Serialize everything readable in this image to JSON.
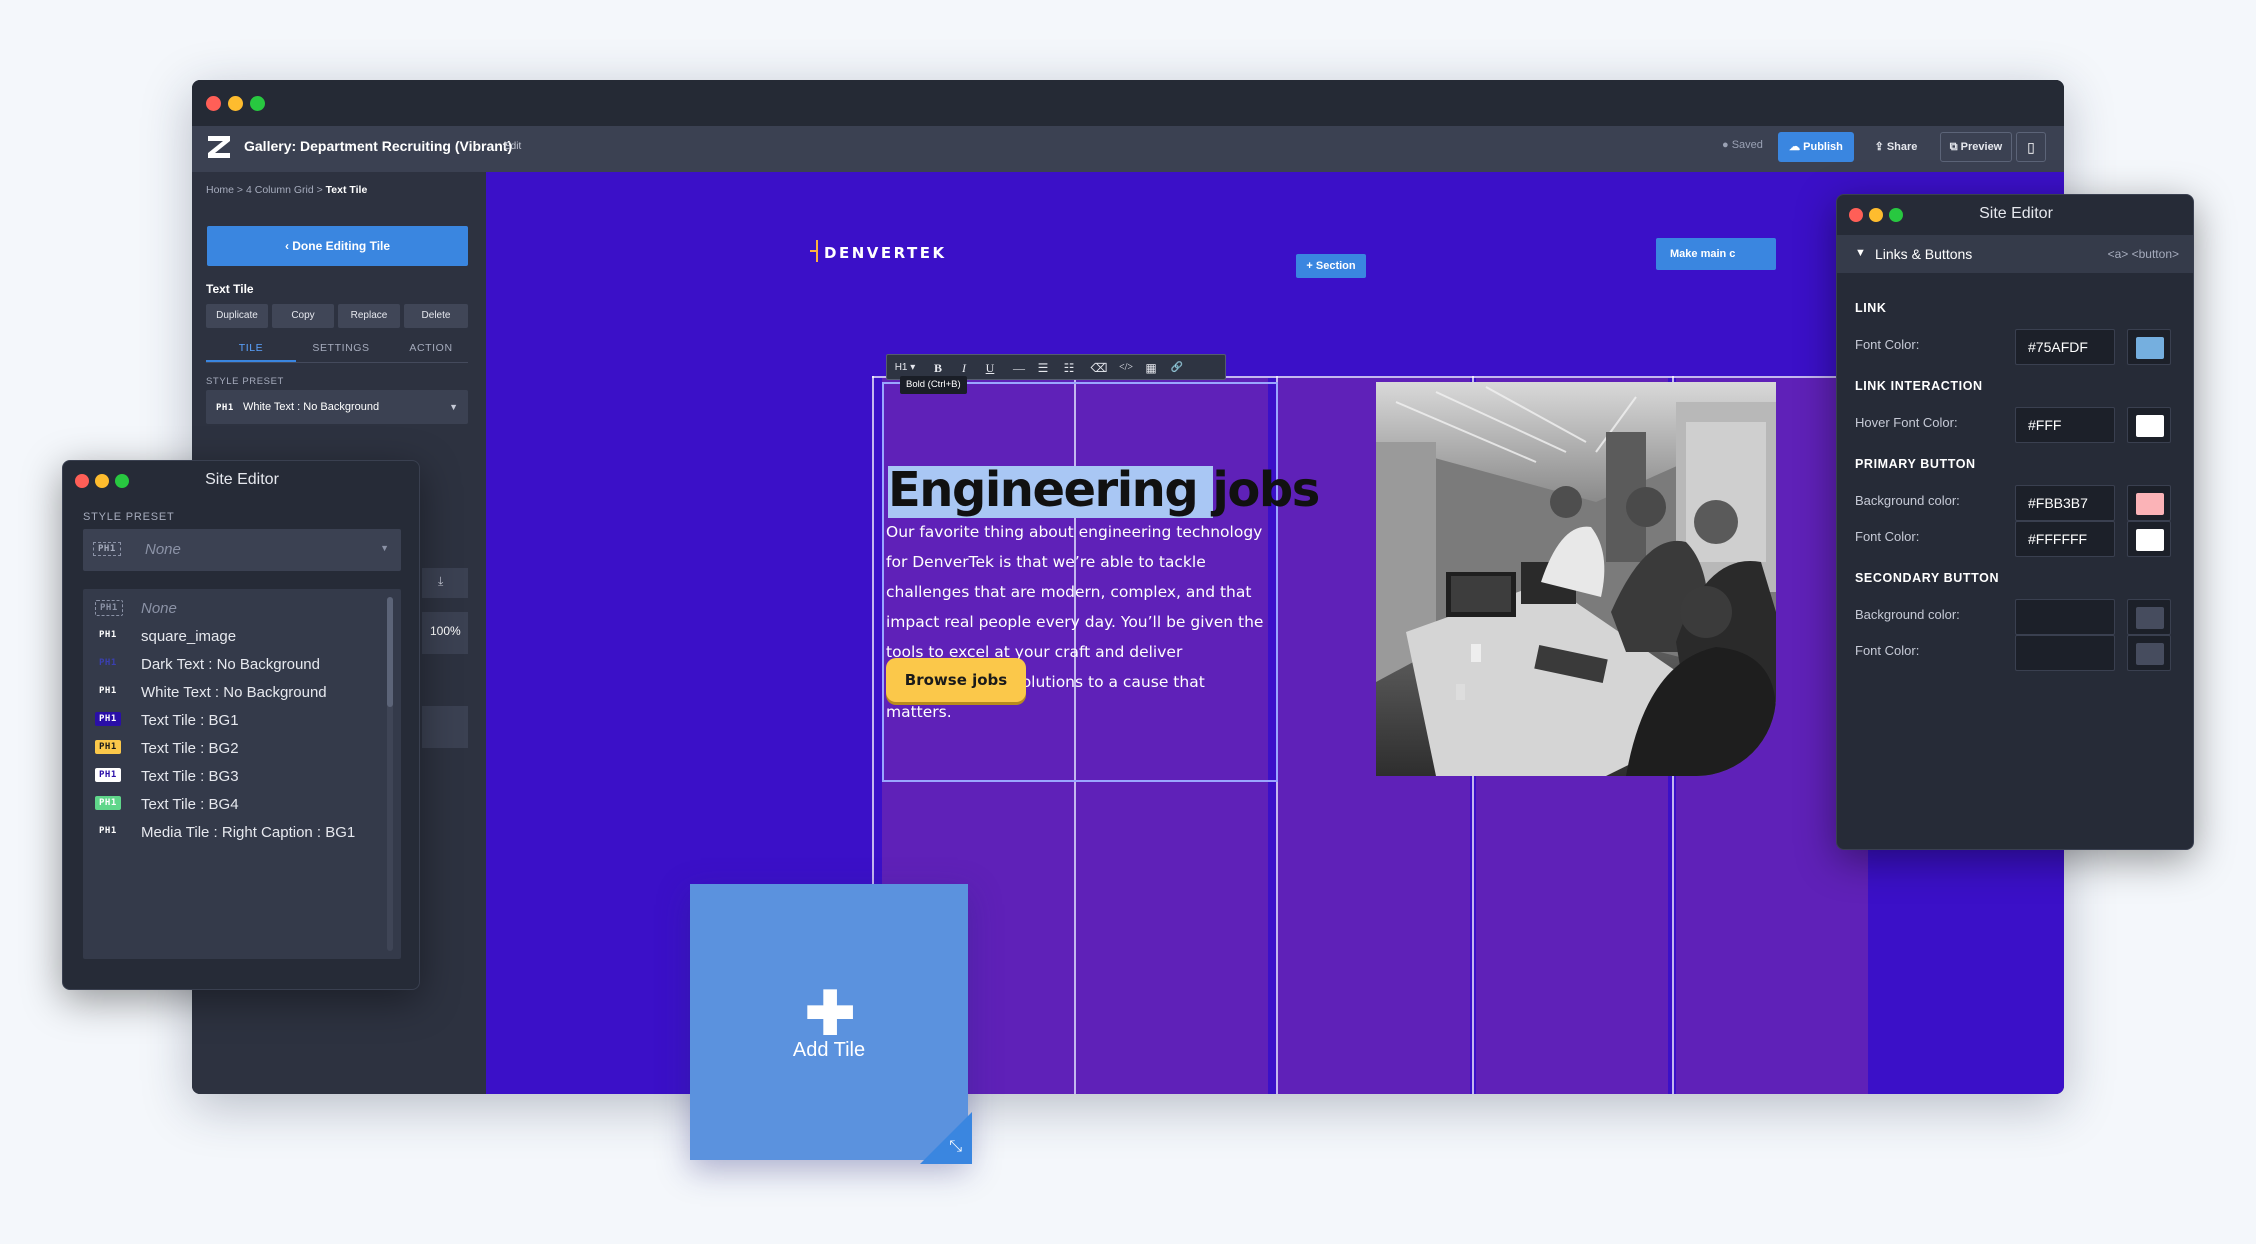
{
  "window": {
    "app_title": "Gallery: Department Recruiting (Vibrant)",
    "edit_link": "Edit",
    "saved_label": "Saved",
    "publish_label": "Publish",
    "share_label": "Share",
    "preview_label": "Preview"
  },
  "sidebar": {
    "breadcrumb": [
      "Home",
      "4 Column Grid",
      "Text Tile"
    ],
    "done_label": "‹ Done Editing Tile",
    "tile_heading": "Text Tile",
    "actions": [
      "Duplicate",
      "Copy",
      "Replace",
      "Delete"
    ],
    "tabs": [
      "TILE",
      "SETTINGS",
      "ACTION"
    ],
    "style_preset_label": "STYLE PRESET",
    "style_preset_value": "White Text : No Background",
    "ph1_badge": "PH1",
    "percent": "100%"
  },
  "canvas": {
    "logo_text": "DENVERTEK",
    "section_button": "+ Section",
    "make_main_button": "Make main c",
    "headline": "Engineering jobs",
    "body": "Our favorite thing about engineering technology for DenverTek is that we’re able to tackle challenges that are modern, complex, and that impact real people every day. You’ll be given the tools to excel at your craft and deliver groundbreaking solutions to a cause that matters.",
    "cta": "Browse jobs",
    "rte_buttons": [
      "H1 ▾",
      "B",
      "I",
      "U",
      "—",
      "☰",
      "☷",
      "⌫",
      "</>",
      "▦",
      "🔗"
    ],
    "tooltip": "Bold (Ctrl+B)",
    "add_tile_label": "Add Tile"
  },
  "site_editor_left": {
    "title": "Site Editor",
    "label": "STYLE PRESET",
    "selected": "None",
    "options": [
      {
        "label": "None",
        "badge": "PH1",
        "badge_color": "#343a4a",
        "text_color": "#8b92a6"
      },
      {
        "label": "square_image",
        "badge": "PH1",
        "badge_color": "transparent",
        "text_color": "#ffffff"
      },
      {
        "label": "Dark Text : No Background",
        "badge": "PH1",
        "badge_color": "transparent",
        "text_color": "#3a3fb0"
      },
      {
        "label": "White Text : No Background",
        "badge": "PH1",
        "badge_color": "transparent",
        "text_color": "#ffffff"
      },
      {
        "label": "Text Tile : BG1",
        "badge": "PH1",
        "badge_color": "#2a0fa8",
        "text_color": "#ffffff"
      },
      {
        "label": "Text Tile : BG2",
        "badge": "PH1",
        "badge_color": "#fbc84a",
        "text_color": "#1a1a1a"
      },
      {
        "label": "Text Tile : BG3",
        "badge": "PH1",
        "badge_color": "#ffffff",
        "text_color": "#2a0fa8"
      },
      {
        "label": "Text Tile : BG4",
        "badge": "PH1",
        "badge_color": "#5fd68a",
        "text_color": "#ffffff"
      },
      {
        "label": "Media Tile : Right Caption : BG1",
        "badge": "PH1",
        "badge_color": "transparent",
        "text_color": "#ffffff"
      }
    ]
  },
  "site_editor_right": {
    "title": "Site Editor",
    "section": "Links & Buttons",
    "tags": "<a> <button>",
    "link_group": "LINK",
    "link_font_label": "Font Color:",
    "link_font_value": "#75AFDF",
    "interaction_group": "LINK INTERACTION",
    "hover_label": "Hover Font Color:",
    "hover_value": "#FFF",
    "primary_group": "PRIMARY BUTTON",
    "primary_bg_label": "Background color:",
    "primary_bg_value": "#FBB3B7",
    "primary_font_label": "Font Color:",
    "primary_font_value": "#FFFFFF",
    "secondary_group": "SECONDARY BUTTON",
    "secondary_bg_label": "Background color:",
    "secondary_font_label": "Font Color:"
  },
  "colors": {
    "canvas_bg": "#3b10c8",
    "column_bg": "#5f21b8",
    "accent": "#3a86e0",
    "cta": "#fbc84a",
    "swatch_link": "#75AFDF",
    "swatch_hover": "#FFFFFF",
    "swatch_primary_bg": "#FBB3B7",
    "swatch_primary_font": "#FFFFFF",
    "swatch_secondary": "#464c5e"
  }
}
